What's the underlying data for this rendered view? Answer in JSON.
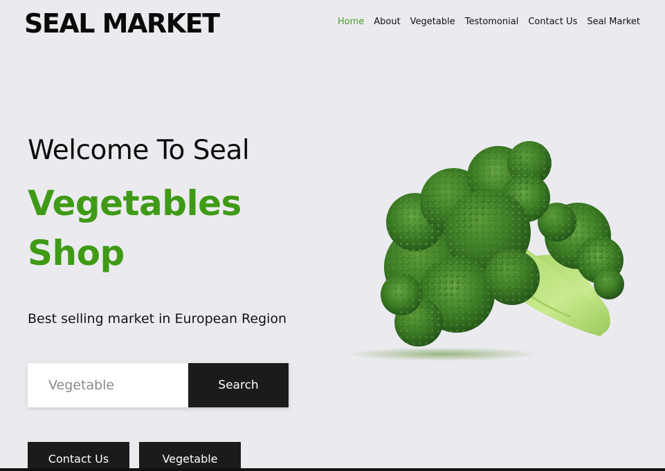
{
  "header": {
    "logo": "SEAL MARKET",
    "nav": [
      {
        "label": "Home",
        "active": true
      },
      {
        "label": "About",
        "active": false
      },
      {
        "label": "Vegetable",
        "active": false
      },
      {
        "label": "Testomonial",
        "active": false
      },
      {
        "label": "Contact Us",
        "active": false
      },
      {
        "label": "Seal Market",
        "active": false
      }
    ]
  },
  "hero": {
    "welcome": "Welcome To Seal",
    "headline_line1": "Vegetables",
    "headline_line2": "Shop",
    "tagline": "Best selling market in European Region",
    "search": {
      "placeholder": "Vegetable",
      "button_label": "Search"
    },
    "buttons": {
      "contact_label": "Contact Us",
      "vegetable_label": "Vegetable"
    },
    "image": "broccoli"
  },
  "colors": {
    "accent_green": "#3f9a16",
    "nav_active": "#4f9a2a",
    "dark": "#1b1b1b",
    "background": "#ebebef"
  }
}
